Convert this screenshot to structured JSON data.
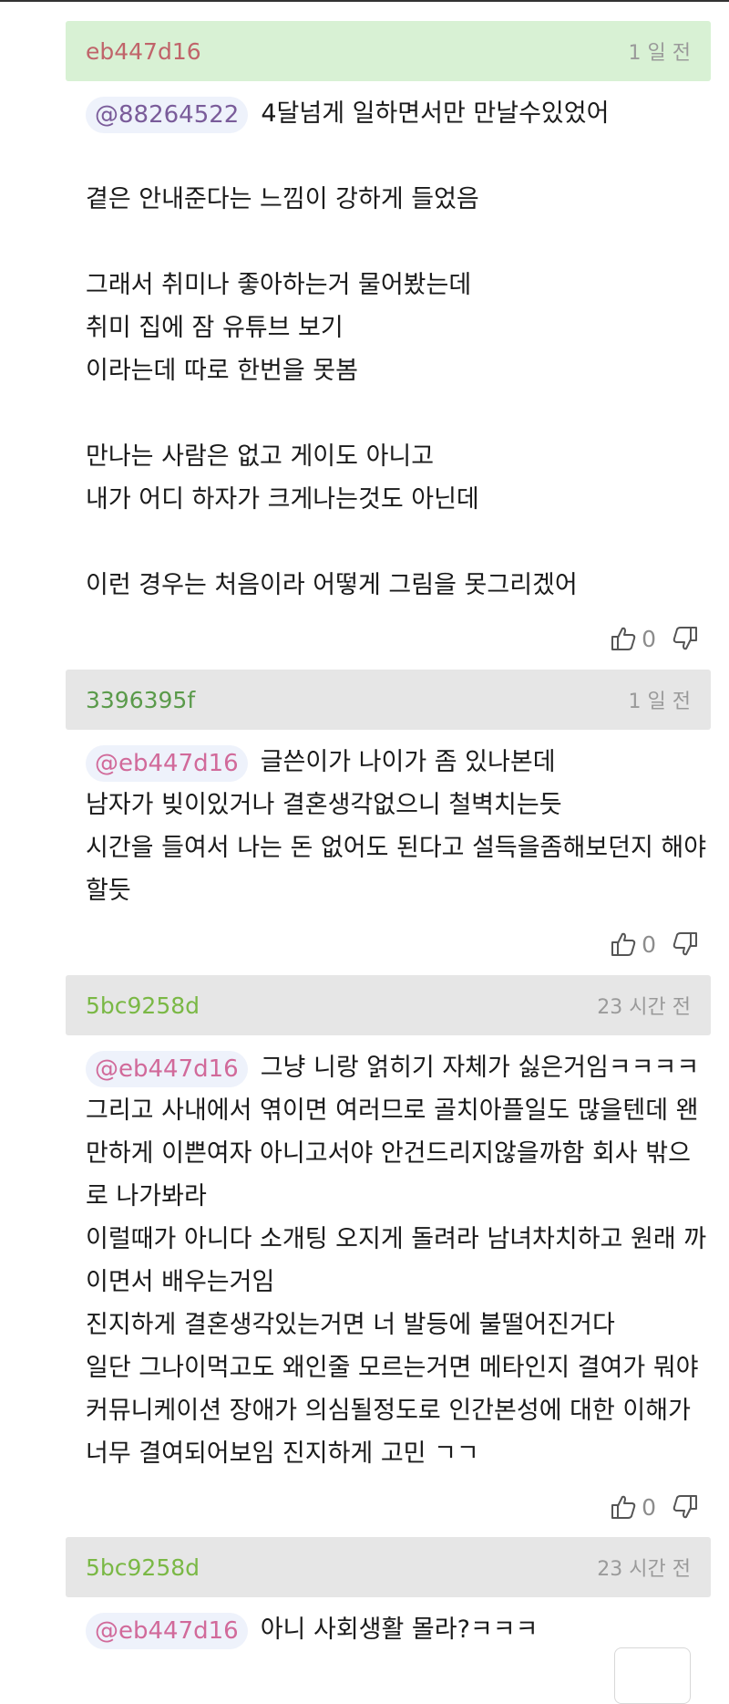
{
  "colors": {
    "header_green": "#d8f1d4",
    "header_gray": "#e6e6e6",
    "author_red": "#c0646a",
    "author_green": "#5a9a4a",
    "author_lightgreen": "#7ab845",
    "mention_bg": "#eef2fb",
    "mention_purple": "#7a5c9a",
    "mention_pink": "#d16a9a",
    "time_gray": "#9a9a9a"
  },
  "comments": [
    {
      "author": "eb447d16",
      "time": "1 일 전",
      "mention": "@88264522",
      "first_line": "4달넘게 일하면서만 만날수있었어",
      "lines": [
        "",
        "곁은 안내준다는 느낌이 강하게 들었음",
        "",
        "그래서 취미나 좋아하는거 물어봤는데",
        "취미 집에 잠 유튜브 보기",
        "이라는데 따로 한번을 못봄",
        "",
        "만나는 사람은 없고 게이도 아니고",
        "내가 어디 하자가 크게나는것도 아닌데",
        "",
        "이런 경우는 처음이라 어떻게 그림을 못그리겠어"
      ],
      "likes": "0"
    },
    {
      "author": "3396395f",
      "time": "1 일 전",
      "mention": "@eb447d16",
      "first_line": "글쓴이가 나이가 좀 있나본데",
      "lines": [
        "남자가 빚이있거나 결혼생각없으니 철벽치는듯",
        "시간을 들여서 나는 돈 없어도 된다고 설득을좀해보던지 해야",
        "할듯"
      ],
      "likes": "0"
    },
    {
      "author": "5bc9258d",
      "time": "23 시간 전",
      "mention": "@eb447d16",
      "first_line": "그냥 니랑 얽히기 자체가 싫은거임ㅋㅋㅋㅋ",
      "lines": [
        "그리고 사내에서 엮이면 여러므로 골치아플일도 많을텐데 왠",
        "만하게 이쁜여자 아니고서야 안건드리지않을까함 회사 밖으",
        "로 나가봐라",
        "이럴때가 아니다 소개팅 오지게 돌려라 남녀차치하고 원래 까",
        "이면서 배우는거임",
        "진지하게 결혼생각있는거면 너 발등에 불떨어진거다",
        "일단 그나이먹고도 왜인줄 모르는거면 메타인지 결여가 뭐야",
        "커뮤니케이션 장애가 의심될정도로 인간본성에 대한 이해가",
        "너무 결여되어보임 진지하게 고민 ㄱㄱ"
      ],
      "likes": "0"
    },
    {
      "author": "5bc9258d",
      "time": "23 시간 전",
      "mention": "@eb447d16",
      "first_line": "아니 사회생활 몰라?ㅋㅋㅋ"
    }
  ]
}
